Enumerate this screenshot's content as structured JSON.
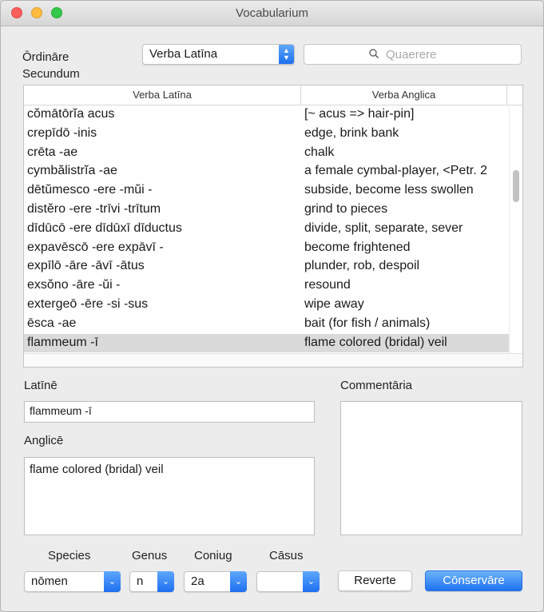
{
  "window": {
    "title": "Vocabularium"
  },
  "sort": {
    "label": "Ōrdināre Secundum",
    "selected": "Verba Latīna"
  },
  "search": {
    "placeholder": "Quaerere"
  },
  "table": {
    "columns": [
      "Verba Latīna",
      "Verba Anglica"
    ],
    "rows": [
      [
        "cŏmātōrĭa acus",
        "[~ acus => hair-pin]"
      ],
      [
        "crepīdō -inis",
        "edge, brink bank"
      ],
      [
        "crēta -ae",
        "chalk"
      ],
      [
        "cymbălistrĭa -ae",
        "a female cymbal-player,  <Petr. 2"
      ],
      [
        "dētŭmesco -ere -mŭi -",
        "subside, become less swollen"
      ],
      [
        "distĕro -ere -trīvi -trītum",
        "grind to pieces"
      ],
      [
        "dīdūcō -ere dīdūxī dīductus",
        "divide, split, separate, sever"
      ],
      [
        "expavēscō -ere expāvī -",
        "become frightened"
      ],
      [
        "expīlō -āre -āvī -ātus",
        "plunder, rob, despoil"
      ],
      [
        "exsŏno -āre -ŭi -",
        "resound"
      ],
      [
        "extergeō -ēre -si -sus",
        "wipe away"
      ],
      [
        "ēsca -ae",
        "bait (for fish / animals)"
      ],
      [
        "flammeum -ī",
        "flame colored (bridal) veil"
      ]
    ],
    "selected_index": 12
  },
  "latin": {
    "label": "Latīnē",
    "value": "flammeum -ī"
  },
  "english": {
    "label": "Anglicē",
    "value": "flame colored (bridal) veil"
  },
  "comments": {
    "label": "Commentāria",
    "value": ""
  },
  "species": {
    "label": "Species",
    "value": "nōmen"
  },
  "genus": {
    "label": "Genus",
    "value": "n"
  },
  "coniug": {
    "label": "Coniug",
    "value": "2a"
  },
  "casus": {
    "label": "Cāsus",
    "value": ""
  },
  "buttons": {
    "revert": "Reverte",
    "save": "Cōnservāre"
  },
  "colors": {
    "accent": "#1f71f0",
    "selection": "#dadada"
  },
  "icons": {
    "search": "search-icon",
    "popup": "chevron-down-icon",
    "stepper": "up-down-stepper-icon"
  }
}
